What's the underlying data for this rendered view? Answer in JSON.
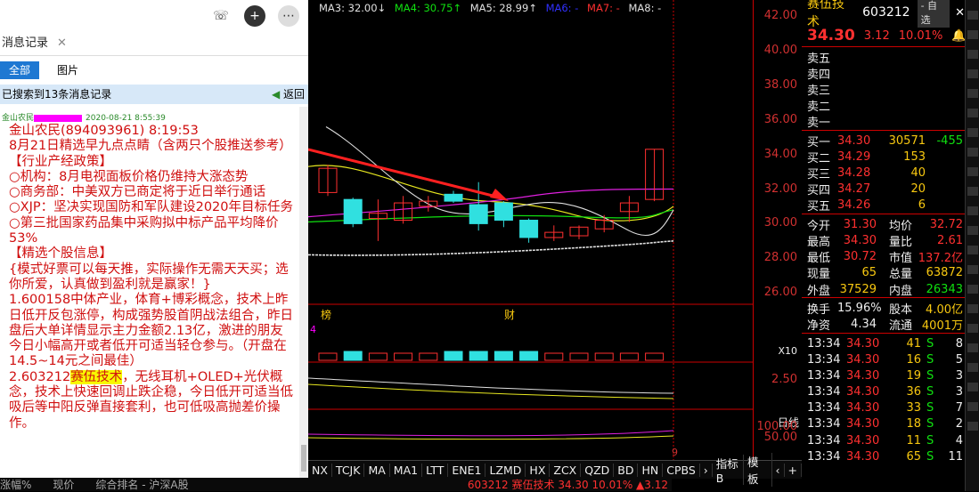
{
  "chat": {
    "header": "消息记录",
    "tabs": [
      "全部",
      "图片"
    ],
    "search_result": "已搜索到13条消息记录",
    "back": "返回",
    "msg_sender_short": "金山农民",
    "msg_time": "2020-08-21 8:55:39",
    "lines": [
      "金山农民(894093961) 8:19:53",
      "8月21日精选早九点点睛（含两只个股推送参考）",
      "【行业产经政策】",
      "○机构：8月电视面板价格仍维持大涨态势",
      "○商务部：中美双方已商定将于近日举行通话",
      "○XJP：坚决实现国防和军队建设2020年目标任务",
      "○第三批国家药品集中采购拟中标产品平均降价53%",
      "【精选个股信息】",
      "{模式好票可以每天推，实际操作无需天天买；选你所爱，认真做到盈利就是赢家！}",
      "1.600158中体产业，体育+博彩概念，技术上昨日低开反包涨停，构成强势股首阴战法组合，昨日盘后大单详情显示主力金额2.13亿，激进的朋友今日小幅高开或者低开可适当轻仓参与。（开盘在14.5~14元之间最佳）"
    ],
    "line_last_prefix": "2.603212",
    "line_last_hl": "赛伍技术",
    "line_last_suffix": "，无线耳机+OLED+光伏概念，技术上快速回调止跌企稳，今日低开可适当低吸后等中阳反弹直接套利，也可低吸高抛差价操作。"
  },
  "chart": {
    "ma": [
      {
        "label": "MA3: 32.00↓",
        "color": "#e0e0e0"
      },
      {
        "label": "MA4: 30.75↑",
        "color": "#10e010"
      },
      {
        "label": "MA5: 28.99↑",
        "color": "#e0e0e0"
      },
      {
        "label": "MA6: -",
        "color": "#3030ff"
      },
      {
        "label": "MA7: -",
        "color": "#ff3030"
      },
      {
        "label": "MA8: -",
        "color": "#e0e0e0"
      }
    ],
    "ticks": [
      "42.00",
      "40.00",
      "38.00",
      "36.00",
      "34.00",
      "32.00",
      "30.00",
      "28.00",
      "26.00"
    ],
    "markers": [
      "榜",
      "财",
      "4"
    ],
    "vol_tick": "X10",
    "ind_tick": "2.50",
    "ind2_ticks": [
      "100.00",
      "50.00"
    ],
    "period": "日线",
    "bottom_items": [
      "NX",
      "TCJK",
      "MA",
      "MA1",
      "LTT",
      "ENE1",
      "LZMD",
      "HX",
      "ZCX",
      "QZD",
      "BD",
      "HN",
      "CPBS",
      "›",
      "指标B",
      "模 板",
      "‹",
      "+"
    ],
    "status": [
      "涨幅%",
      "现价",
      "综合排名 - 沪深A股",
      "603212 赛伍技术  34.30 10.01% ▲3.12"
    ],
    "date_marker": "9",
    "candles": [
      {
        "o": 31.8,
        "c": 33.2,
        "h": 33.4,
        "l": 31.6
      },
      {
        "o": 31.4,
        "c": 30.0,
        "h": 31.5,
        "l": 29.8
      },
      {
        "o": 30.3,
        "c": 30.6,
        "h": 31.4,
        "l": 29.0
      },
      {
        "o": 30.2,
        "c": 31.2,
        "h": 31.6,
        "l": 30.0
      },
      {
        "o": 31.0,
        "c": 31.3,
        "h": 31.6,
        "l": 30.7
      },
      {
        "o": 31.7,
        "c": 31.3,
        "h": 31.9,
        "l": 31.2
      },
      {
        "o": 31.1,
        "c": 30.0,
        "h": 32.4,
        "l": 29.6
      },
      {
        "o": 31.2,
        "c": 30.2,
        "h": 31.3,
        "l": 29.8
      },
      {
        "o": 30.2,
        "c": 29.2,
        "h": 30.3,
        "l": 28.9
      },
      {
        "o": 29.2,
        "c": 29.5,
        "h": 29.9,
        "l": 29.0
      },
      {
        "o": 29.3,
        "c": 29.8,
        "h": 29.9,
        "l": 29.1
      },
      {
        "o": 29.7,
        "c": 30.2,
        "h": 30.5,
        "l": 29.5
      },
      {
        "o": 30.7,
        "c": 31.2,
        "h": 31.6,
        "l": 30.1
      },
      {
        "o": 31.4,
        "c": 34.3,
        "h": 34.3,
        "l": 31.3
      }
    ]
  },
  "quote": {
    "name": "赛伍技术",
    "code": "603212",
    "btn": "- 自选",
    "price": "34.30",
    "chg": "3.12",
    "pct": "10.01%",
    "sell": [
      {
        "l": "卖五",
        "p": "",
        "v": "",
        "d": ""
      },
      {
        "l": "卖四",
        "p": "",
        "v": "",
        "d": ""
      },
      {
        "l": "卖三",
        "p": "",
        "v": "",
        "d": ""
      },
      {
        "l": "卖二",
        "p": "",
        "v": "",
        "d": ""
      },
      {
        "l": "卖一",
        "p": "",
        "v": "",
        "d": ""
      }
    ],
    "buy": [
      {
        "l": "买一",
        "p": "34.30",
        "v": "30571",
        "d": "-455"
      },
      {
        "l": "买二",
        "p": "34.29",
        "v": "153",
        "d": ""
      },
      {
        "l": "买三",
        "p": "34.28",
        "v": "40",
        "d": ""
      },
      {
        "l": "买四",
        "p": "34.27",
        "v": "20",
        "d": ""
      },
      {
        "l": "买五",
        "p": "34.26",
        "v": "6",
        "d": ""
      }
    ],
    "stats": [
      [
        "今开",
        "31.30",
        "均价",
        "32.72"
      ],
      [
        "最高",
        "34.30",
        "量比",
        "2.61"
      ],
      [
        "最低",
        "30.72",
        "市值",
        "137.2亿"
      ],
      [
        "现量",
        "65",
        "总量",
        "63872"
      ],
      [
        "外盘",
        "37529",
        "内盘",
        "26343"
      ]
    ],
    "stats2": [
      [
        "换手",
        "15.96%",
        "股本",
        "4.00亿"
      ],
      [
        "净资",
        "4.34",
        "流通",
        "4001万"
      ]
    ],
    "ticks": [
      [
        "13:34",
        "34.30",
        "41",
        "S",
        "8"
      ],
      [
        "13:34",
        "34.30",
        "16",
        "S",
        "5"
      ],
      [
        "13:34",
        "34.30",
        "19",
        "S",
        "3"
      ],
      [
        "13:34",
        "34.30",
        "36",
        "S",
        "3"
      ],
      [
        "13:34",
        "34.30",
        "33",
        "S",
        "7"
      ],
      [
        "13:34",
        "34.30",
        "18",
        "S",
        "2"
      ],
      [
        "13:34",
        "34.30",
        "11",
        "S",
        "4"
      ],
      [
        "13:34",
        "34.30",
        "65",
        "S",
        "11"
      ]
    ]
  }
}
